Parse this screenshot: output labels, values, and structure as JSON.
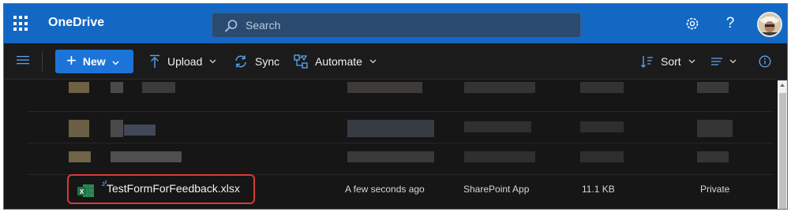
{
  "app": {
    "name": "OneDrive",
    "search_placeholder": "Search",
    "settings_icon": "gear-icon",
    "help_label": "?"
  },
  "commands": {
    "new_label": "New",
    "upload_label": "Upload",
    "sync_label": "Sync",
    "automate_label": "Automate",
    "sort_label": "Sort"
  },
  "file": {
    "name": "TestFormForFeedback.xlsx",
    "modified": "A few seconds ago",
    "modified_by": "SharePoint App",
    "size": "11.1 KB",
    "sharing": "Private"
  },
  "colors": {
    "suite_bar": "#1368c4",
    "accent": "#1d74d8",
    "highlight": "#d93a3a",
    "excel": "#1e7145"
  }
}
